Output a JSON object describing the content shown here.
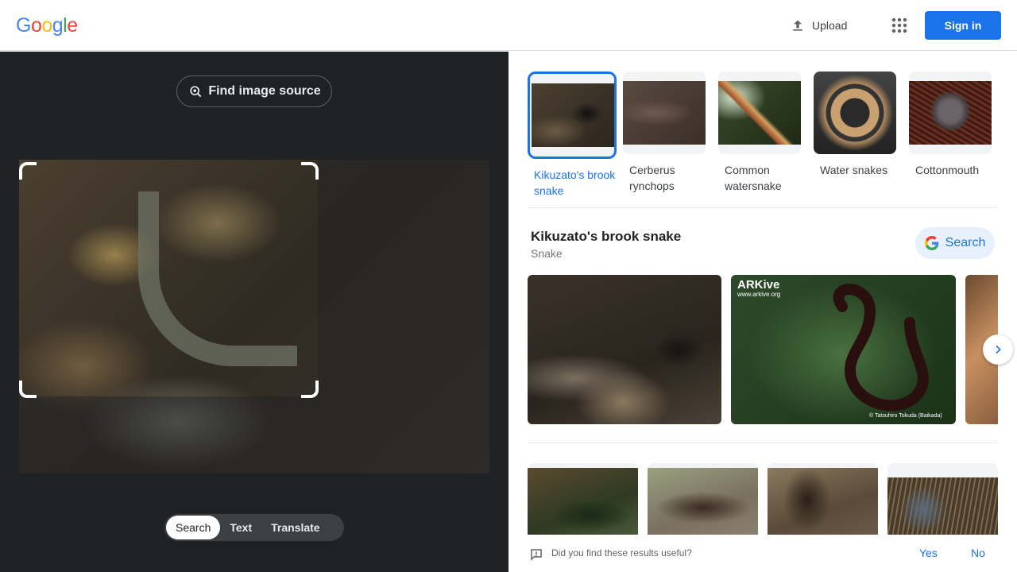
{
  "header": {
    "logo_letters": [
      "G",
      "o",
      "o",
      "g",
      "l",
      "e"
    ],
    "logo_colors": [
      "#4285F4",
      "#EA4335",
      "#FBBC05",
      "#4285F4",
      "#34A853",
      "#EA4335"
    ],
    "upload_label": "Upload",
    "apps_icon": "apps-grid-icon",
    "signin_label": "Sign in"
  },
  "left": {
    "find_source_label": "Find image source",
    "modes": [
      "Search",
      "Text",
      "Translate"
    ],
    "active_mode": "Search"
  },
  "right": {
    "suggestions": [
      {
        "label": "Kikuzato's brook snake",
        "selected": true
      },
      {
        "label": "Cerberus rynchops",
        "selected": false
      },
      {
        "label": "Common watersnake",
        "selected": false
      },
      {
        "label": "Water snakes",
        "selected": false
      },
      {
        "label": "Cottonmouth",
        "selected": false
      }
    ],
    "entity": {
      "title": "Kikuzato's brook snake",
      "subtitle": "Snake",
      "search_label": "Search"
    },
    "watermark": {
      "brand": "ARKive",
      "site": "www.arkive.org",
      "credit": "© Tatsuhiro Tokuda (Baikada)"
    },
    "feedback": {
      "question": "Did you find these results useful?",
      "yes": "Yes",
      "no": "No"
    }
  },
  "colors": {
    "accent": "#1a73e8",
    "dark_panel": "#202124"
  }
}
